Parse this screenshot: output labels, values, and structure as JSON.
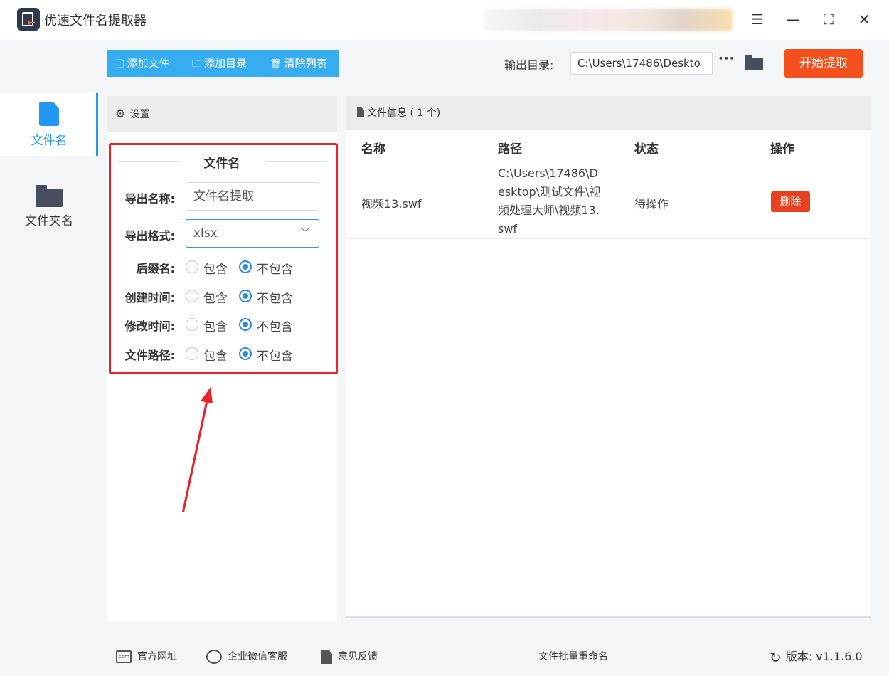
{
  "window": {
    "title": "优速文件名提取器",
    "controls": {
      "menu": "☰",
      "minimize": "—",
      "maximize": "⛶",
      "close": "✕"
    }
  },
  "sidebar": {
    "items": [
      {
        "label": "文件名",
        "icon": "file-icon",
        "active": true
      },
      {
        "label": "文件夹名",
        "icon": "folder-icon",
        "active": false
      }
    ]
  },
  "toolbar": {
    "add_file": "添加文件",
    "add_dir": "添加目录",
    "clear_list": "清除列表",
    "output_label": "输出目录:",
    "output_path": "C:\\Users\\17486\\Deskto",
    "more": "···",
    "start": "开始提取"
  },
  "settings": {
    "header": "设置",
    "section_title": "文件名",
    "export_name_label": "导出名称:",
    "export_name_value": "文件名提取",
    "export_format_label": "导出格式:",
    "export_format_value": "xlsx",
    "options": [
      {
        "label": "后缀名:",
        "include": "包含",
        "exclude": "不包含",
        "selected": "exclude"
      },
      {
        "label": "创建时间:",
        "include": "包含",
        "exclude": "不包含",
        "selected": "exclude"
      },
      {
        "label": "修改时间:",
        "include": "包含",
        "exclude": "不包含",
        "selected": "exclude"
      },
      {
        "label": "文件路径:",
        "include": "包含",
        "exclude": "不包含",
        "selected": "exclude"
      }
    ]
  },
  "files": {
    "header": "文件信息 ( 1 个)",
    "columns": [
      "名称",
      "路径",
      "状态",
      "操作"
    ],
    "rows": [
      {
        "name": "视频13.swf",
        "path": "C:\\Users\\17486\\Desktop\\测试文件\\视频处理大师\\视频13.swf",
        "status": "待操作",
        "action": "删除"
      }
    ]
  },
  "footer": {
    "website": "官方网址",
    "wechat": "企业微信客服",
    "feedback": "意见反馈",
    "rename": "文件批量重命名",
    "version": "版本: v1.1.6.0"
  },
  "colors": {
    "accent": "#2196f3",
    "toolbar": "#35adf0",
    "start": "#f4501e",
    "delete": "#e8411f",
    "highlight": "#e8232a"
  }
}
